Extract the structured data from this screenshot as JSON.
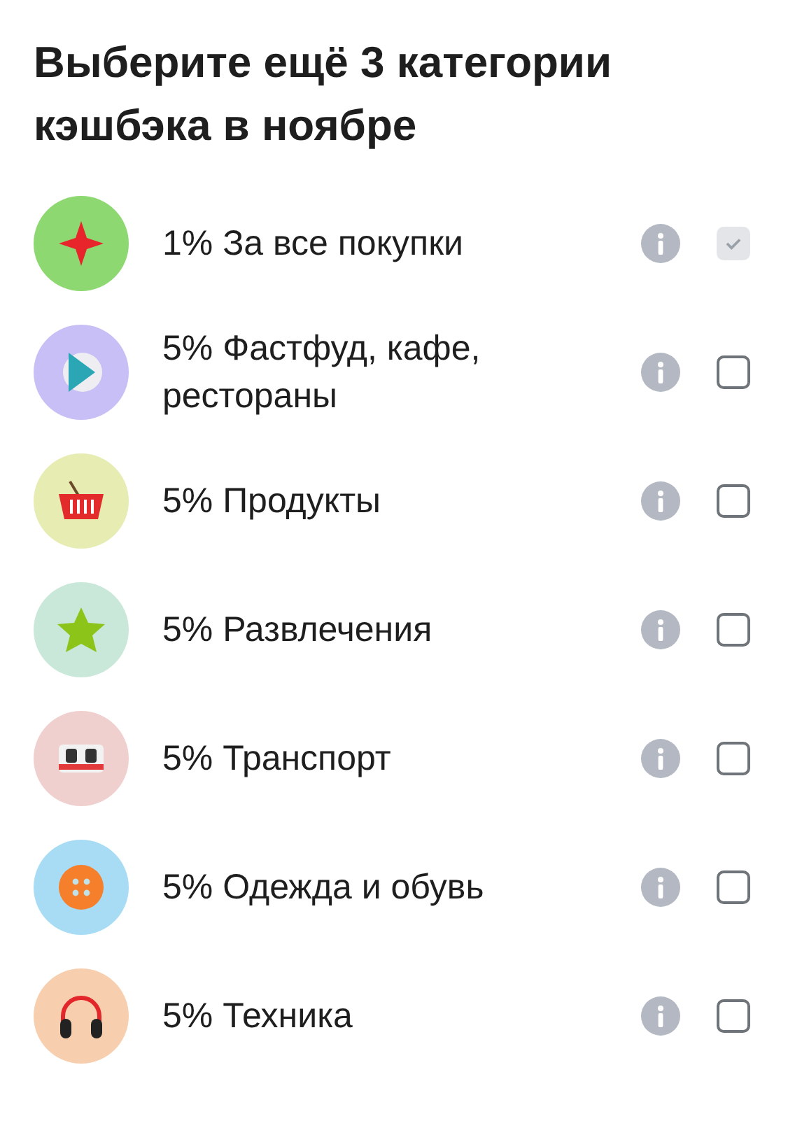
{
  "title": "Выберите ещё 3 категории кэшбэка в ноябре",
  "categories": [
    {
      "label": "1% За все покупки",
      "color": "#8ed872",
      "checked": true,
      "disabled": true
    },
    {
      "label": "5% Фастфуд, кафе, рестораны",
      "color": "#c7bff5",
      "checked": false,
      "disabled": false
    },
    {
      "label": "5% Продукты",
      "color": "#e6ecb2",
      "checked": false,
      "disabled": false
    },
    {
      "label": "5% Развлечения",
      "color": "#c9e8d9",
      "checked": false,
      "disabled": false
    },
    {
      "label": "5% Транспорт",
      "color": "#f0d0cf",
      "checked": false,
      "disabled": false
    },
    {
      "label": "5% Одежда и обувь",
      "color": "#a8dcf5",
      "checked": false,
      "disabled": false
    },
    {
      "label": "5% Техника",
      "color": "#f8cfae",
      "checked": false,
      "disabled": false
    }
  ]
}
